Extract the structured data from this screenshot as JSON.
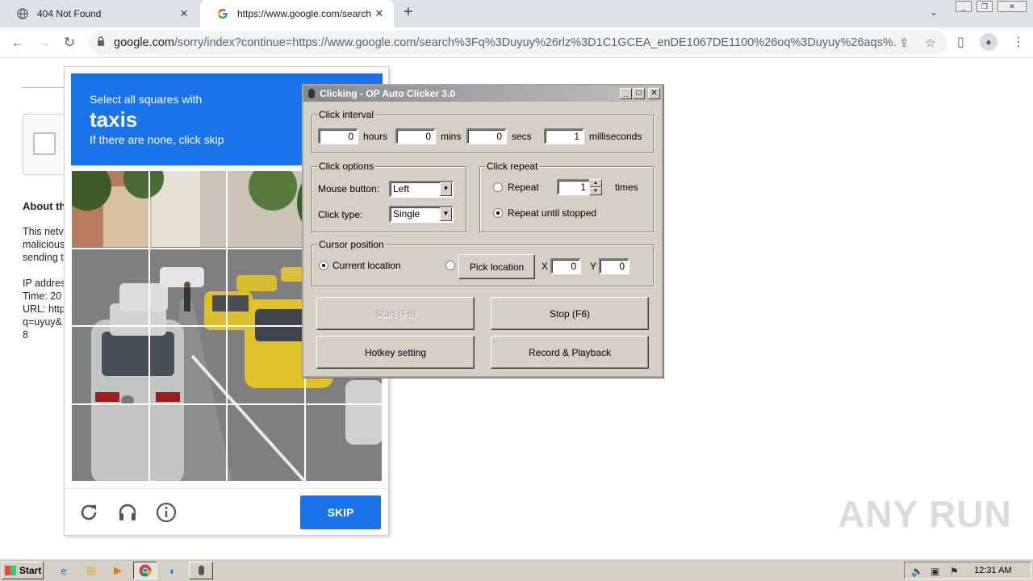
{
  "browser": {
    "tabs": [
      {
        "title": "404 Not Found",
        "icon": "globe-icon"
      },
      {
        "title": "https://www.google.com/search?q=",
        "icon": "google-icon"
      }
    ],
    "new_tab": "+",
    "url_domain": "google.com",
    "url_rest": "/sorry/index?continue=https://www.google.com/search%3Fq%3Duyuy%26rlz%3D1C1GCEA_enDE1067DE1100%26oq%3Duyuy%26aqs%..."
  },
  "page": {
    "about_heading": "About th",
    "lines": [
      "This netv",
      "malicious",
      "sending t",
      "",
      "IP addres",
      "Time: 20",
      "URL: http",
      "q=uyuy&",
      "8"
    ]
  },
  "captcha": {
    "line1": "Select all squares with",
    "target": "taxis",
    "line3": "If there are none, click skip",
    "skip_label": "SKIP",
    "footer_icons": [
      "reload-icon",
      "audio-icon",
      "info-icon"
    ],
    "accent": "#1a73e8"
  },
  "clicker": {
    "title": "Clicking - OP Auto Clicker 3.0",
    "interval": {
      "label": "Click interval",
      "hours": "0",
      "hours_label": "hours",
      "mins": "0",
      "mins_label": "mins",
      "secs": "0",
      "secs_label": "secs",
      "ms": "1",
      "ms_label": "milliseconds"
    },
    "options": {
      "label": "Click options",
      "mouse_button_label": "Mouse button:",
      "mouse_button": "Left",
      "click_type_label": "Click type:",
      "click_type": "Single"
    },
    "repeat": {
      "label": "Click repeat",
      "repeat_label": "Repeat",
      "repeat_count": "1",
      "times_label": "times",
      "until_stopped_label": "Repeat until stopped",
      "selected": "until_stopped"
    },
    "cursor": {
      "label": "Cursor position",
      "current_label": "Current location",
      "pick_label": "Pick location",
      "x_label": "X",
      "x": "0",
      "y_label": "Y",
      "y": "0",
      "selected": "current"
    },
    "buttons": {
      "start": "Start (F6)",
      "stop": "Stop (F6)",
      "hotkey": "Hotkey setting",
      "record": "Record & Playback"
    }
  },
  "watermark": "ANY RUN",
  "taskbar": {
    "start_label": "Start",
    "clock": "12:31 AM"
  }
}
